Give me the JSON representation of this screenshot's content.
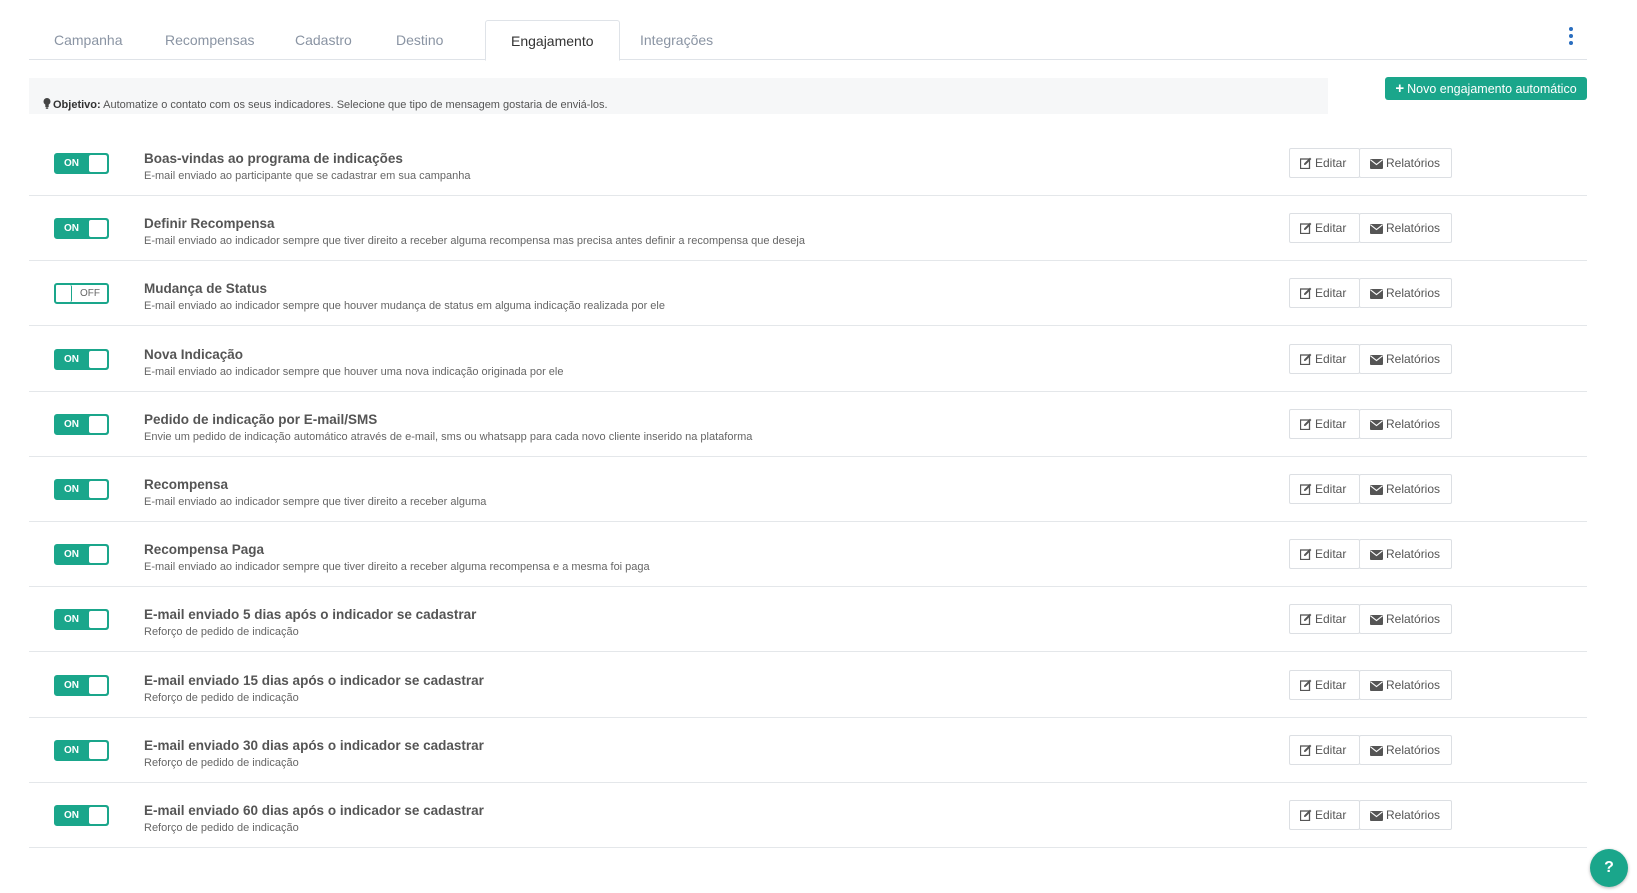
{
  "tabs": [
    {
      "label": "Campanha"
    },
    {
      "label": "Recompensas"
    },
    {
      "label": "Cadastro"
    },
    {
      "label": "Destino"
    },
    {
      "label": "Engajamento"
    },
    {
      "label": "Integrações"
    }
  ],
  "active_tab": "Engajamento",
  "objective": {
    "label": "Objetivo:",
    "text": "Automatize o contato com os seus indicadores. Selecione que tipo de mensagem gostaria de enviá-los."
  },
  "new_button": {
    "plus": "+",
    "label": "Novo engajamento automático"
  },
  "buttons": {
    "edit": "Editar",
    "reports": "Relatórios"
  },
  "engagements": [
    {
      "state": "ON",
      "title": "Boas-vindas ao programa de indicações",
      "description": "E-mail enviado ao participante que se cadastrar em sua campanha"
    },
    {
      "state": "ON",
      "title": "Definir Recompensa",
      "description": "E-mail enviado ao indicador sempre que tiver direito a receber alguma recompensa mas precisa antes definir a recompensa que deseja"
    },
    {
      "state": "OFF",
      "title": "Mudança de Status",
      "description": "E-mail enviado ao indicador sempre que houver mudança de status em alguma indicação realizada por ele"
    },
    {
      "state": "ON",
      "title": "Nova Indicação",
      "description": "E-mail enviado ao indicador sempre que houver uma nova indicação originada por ele"
    },
    {
      "state": "ON",
      "title": "Pedido de indicação por E-mail/SMS",
      "description": "Envie um pedido de indicação automático através de e-mail, sms ou whatsapp para cada novo cliente inserido na plataforma"
    },
    {
      "state": "ON",
      "title": "Recompensa",
      "description": "E-mail enviado ao indicador sempre que tiver direito a receber alguma"
    },
    {
      "state": "ON",
      "title": "Recompensa Paga",
      "description": "E-mail enviado ao indicador sempre que tiver direito a receber alguma recompensa e a mesma foi paga"
    },
    {
      "state": "ON",
      "title": "E-mail enviado 5 dias após o indicador se cadastrar",
      "description": "Reforço de pedido de indicação"
    },
    {
      "state": "ON",
      "title": "E-mail enviado 15 dias após o indicador se cadastrar",
      "description": "Reforço de pedido de indicação"
    },
    {
      "state": "ON",
      "title": "E-mail enviado 30 dias após o indicador se cadastrar",
      "description": "Reforço de pedido de indicação"
    },
    {
      "state": "ON",
      "title": "E-mail enviado 60 dias após o indicador se cadastrar",
      "description": "Reforço de pedido de indicação"
    }
  ],
  "help_button": {
    "label": "?"
  },
  "colors": {
    "accent": "#1aa68b",
    "kebab": "#2a6ebf"
  },
  "icons": {
    "objective": "lightbulb-icon",
    "edit": "edit-icon",
    "reports": "envelope-icon",
    "menu": "kebab-menu-icon"
  }
}
